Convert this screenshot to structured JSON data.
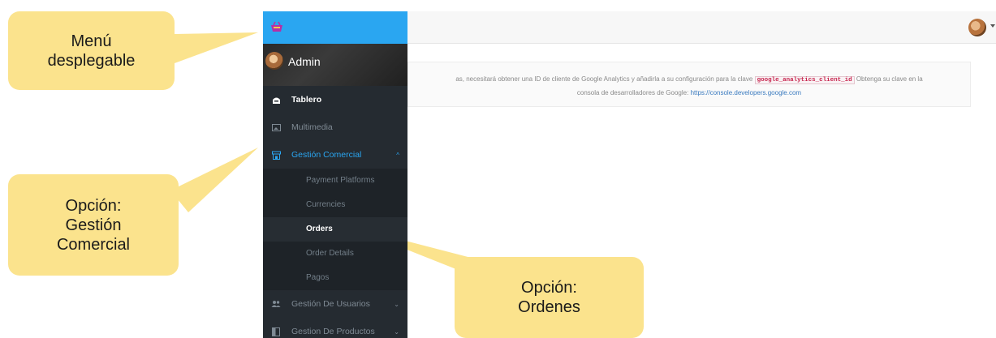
{
  "header": {
    "user_menu": "avatar"
  },
  "sidebar": {
    "brand_icon": "shop-basket-icon",
    "profile_name": "Admin",
    "items": [
      {
        "label": "Tablero",
        "icon": "dashboard-icon"
      },
      {
        "label": "Multimedia",
        "icon": "image-icon"
      },
      {
        "label": "Gestión Comercial",
        "icon": "store-icon",
        "chevron": "^"
      },
      {
        "label": "Gestión De Usuarios",
        "icon": "users-icon",
        "chevron": "⌄"
      },
      {
        "label": "Gestion De Productos",
        "icon": "box-icon",
        "chevron": "⌄"
      }
    ],
    "submenu": [
      "Payment Platforms",
      "Currencies",
      "Orders",
      "Order Details",
      "Pagos"
    ]
  },
  "notice": {
    "text_before": "as, necesitará obtener una ID de cliente de Google Analytics y añadirla a su configuración para la clave",
    "code": "google_analytics_client_id",
    "text_after": "Obtenga su clave en la",
    "line2": "consola de desarrolladores de Google:",
    "link": "https://console.developers.google.com"
  },
  "callouts": {
    "menu": "Menú desplegable",
    "gestion_1": "Opción:",
    "gestion_2": "Gestión",
    "gestion_3": "Comercial",
    "ordenes_1": "Opción:",
    "ordenes_2": "Ordenes"
  },
  "colors": {
    "accent": "#2aa6f1",
    "sidebar": "#252b31",
    "callout": "#fbe38d"
  }
}
